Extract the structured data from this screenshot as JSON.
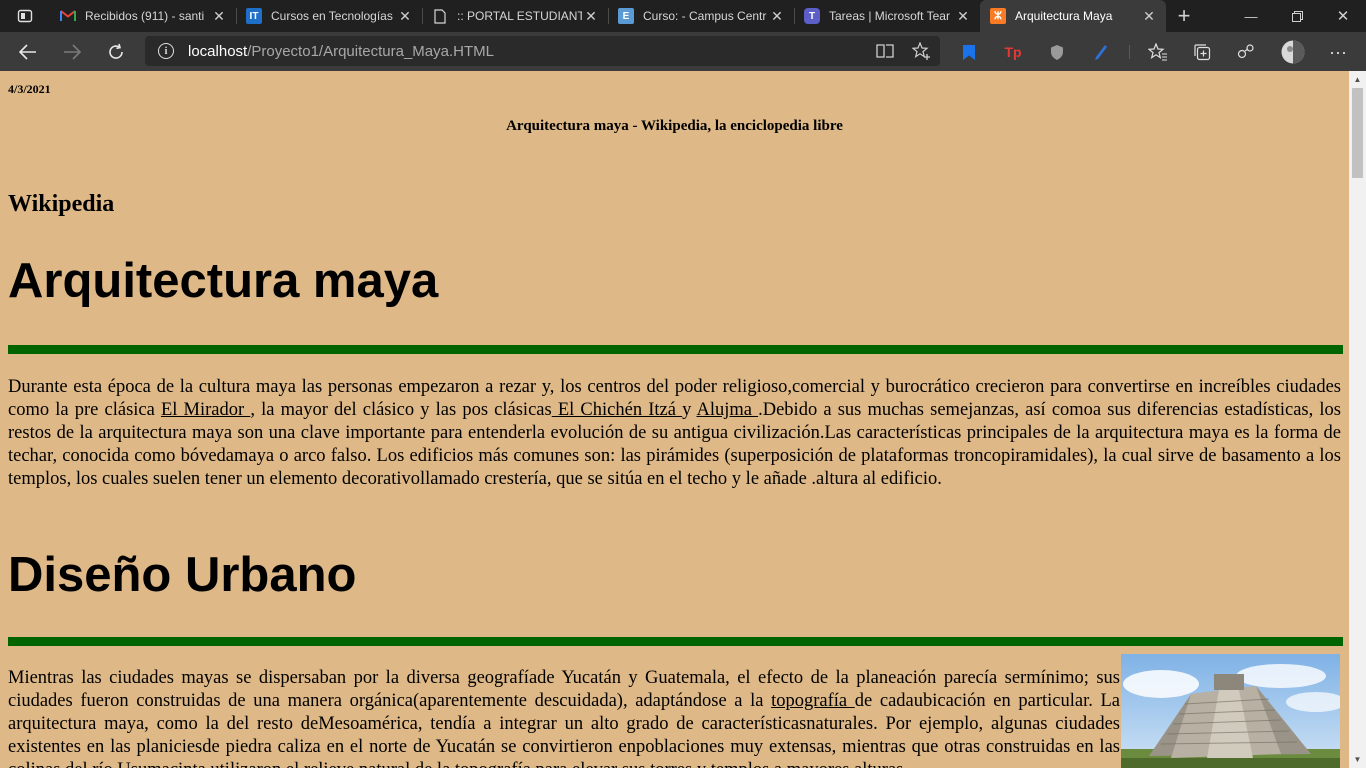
{
  "browser": {
    "tabs": [
      {
        "title": "Recibidos (911) - santi",
        "favicon": "gmail-icon",
        "active": false
      },
      {
        "title": "Cursos en Tecnologías",
        "favicon": "it-icon",
        "active": false
      },
      {
        "title": ":: PORTAL ESTUDIANTE",
        "favicon": "page-icon",
        "active": false
      },
      {
        "title": "Curso: - Campus Centr",
        "favicon": "campus-icon",
        "active": false
      },
      {
        "title": "Tareas | Microsoft Tear",
        "favicon": "teams-icon",
        "active": false
      },
      {
        "title": "Arquitectura Maya",
        "favicon": "xampp-icon",
        "active": true
      }
    ],
    "address": {
      "host": "localhost",
      "path": "/Proyecto1/Arquitectura_Maya.HTML"
    }
  },
  "page": {
    "date": "4/3/2021",
    "header_title": "Arquitectura maya - Wikipedia, la enciclopedia libre",
    "site_name": "Wikipedia",
    "heading1": "Arquitectura maya",
    "para1": {
      "t1": "Durante esta época de la cultura maya las personas empezaron a rezar y, los centros del poder religioso,comercial y burocrático crecieron para convertirse en increíbles ciudades como la pre clásica ",
      "link1": "El Mirador ",
      "t2": ", la mayor del clásico y las pos clásicas",
      "link2": " El Chichén Itzá ",
      "t3": "y ",
      "link3": "Alujma ",
      "t4": ".Debido a sus muchas semejanzas, así comoa sus diferencias estadísticas, los restos de la arquitectura maya son una clave importante para entenderla evolución de su antigua civilización.Las características principales de la arquitectura maya es la forma de techar, conocida como bóvedamaya o arco falso. Los edificios más comunes son: las pirámides (superposición de plataformas troncopiramidales), la cual sirve de basamento a los templos, los cuales suelen tener un elemento decorativollamado crestería, que se sitúa en el techo y le añade .altura al edificio."
    },
    "heading2": "Diseño Urbano",
    "para2": {
      "t1": "Mientras las ciudades mayas se dispersaban por la diversa geografíade Yucatán y Guatemala, el efecto de la planeación parecía sermínimo; sus ciudades fueron construidas de una manera orgánica(aparentemente descuidada), adaptándose a la ",
      "link1": "topografía ",
      "t2": "de cadaubicación en particular. La arquitectura maya, como la del resto deMesoamérica, tendía a integrar un alto grado de característicasnaturales. Por ejemplo, algunas ciudades existentes en las planiciesde piedra caliza en el norte de Yucatán se convirtieron enpoblaciones muy extensas, mientras que otras construidas en las colinas del río Usumacinta utilizaron el relieve natural de la topografía para elevar sus torres y templos a mayores alturas."
    },
    "colors": {
      "background": "#deb887",
      "rule": "#006400"
    }
  }
}
